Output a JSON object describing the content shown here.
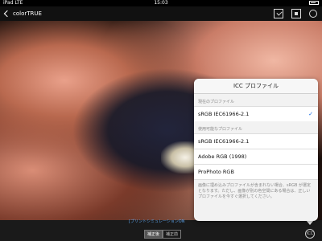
{
  "status_bar": {
    "carrier": "iPad  LTE",
    "time": "15:03"
  },
  "nav": {
    "back_label": "colorTRUE",
    "icons": [
      "export-icon",
      "display-icon",
      "bulb-icon"
    ]
  },
  "caption": {
    "link_text": "[プリントシミュレーションON"
  },
  "segments": {
    "left": "補正後",
    "right": "補正前",
    "active": "left"
  },
  "icc_toggle_label": "ICC",
  "popover": {
    "title": "ICC プロファイル",
    "current_section": "現在のプロファイル",
    "current_profile": "sRGB IEC61966-2.1",
    "available_section": "使用可能なプロファイル",
    "available_profiles": [
      "sRGB IEC61966-2.1",
      "Adobe RGB (1998)",
      "ProPhoto RGB"
    ],
    "note": "画像に埋め込みプロファイルが含まれない場合、sRGB が選定となります。ただし、画像が別の色空間にある場合は、正しいプロファイルを今すぐ選択してください。"
  },
  "colors": {
    "accent": "#1a6ee6",
    "link": "#5aa0e6"
  }
}
